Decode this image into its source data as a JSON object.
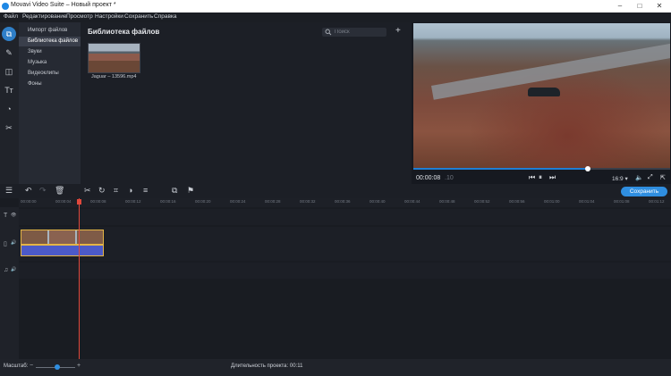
{
  "window": {
    "title": "Movavi Video Suite – Новый проект *",
    "controls": {
      "minimize": "–",
      "maximize": "□",
      "close": "✕"
    }
  },
  "menu": [
    "Файл",
    "Редактирование",
    "Просмотр",
    "Настройки",
    "Сохранить",
    "Справка"
  ],
  "toolbar_icons": [
    "import-icon",
    "wand-icon",
    "transitions-icon",
    "titles-icon",
    "stickers-icon",
    "tools-icon"
  ],
  "side_menu": [
    "Импорт файлов",
    "Библиотека файлов",
    "Звуки",
    "Музыка",
    "Видеоклипы",
    "Фоны"
  ],
  "side_menu_active": 1,
  "library": {
    "title": "Библиотека файлов",
    "search_placeholder": "Поиск",
    "add_label": "+",
    "file_name": "Jaguar – 13596.mp4"
  },
  "player": {
    "current_time": "00:00:08",
    "total_time": ".10",
    "aspect_ratio": "16:9 ▾",
    "progress": 0.68,
    "prev": "⏮",
    "pause": "⏸",
    "next": "⏭"
  },
  "timeline": {
    "ruler": [
      "00:00:00",
      "00:00:04",
      "00:00:08",
      "00:00:12",
      "00:00:16",
      "00:00:20",
      "00:00:24",
      "00:00:28",
      "00:00:32",
      "00:00:36",
      "00:00:40",
      "00:00:44",
      "00:00:48",
      "00:00:52",
      "00:00:56",
      "00:01:00",
      "00:01:04",
      "00:01:08",
      "00:01:12",
      "00:01:16"
    ],
    "export_label": "Сохранить"
  },
  "status": {
    "zoom_label": "Масштаб:",
    "duration": "Длительность проекта: 00:11"
  },
  "colors": {
    "accent": "#2f8ee0",
    "playhead": "#e0483c",
    "clip_border": "#e5b545",
    "audio_clip": "#4c5ac8"
  }
}
